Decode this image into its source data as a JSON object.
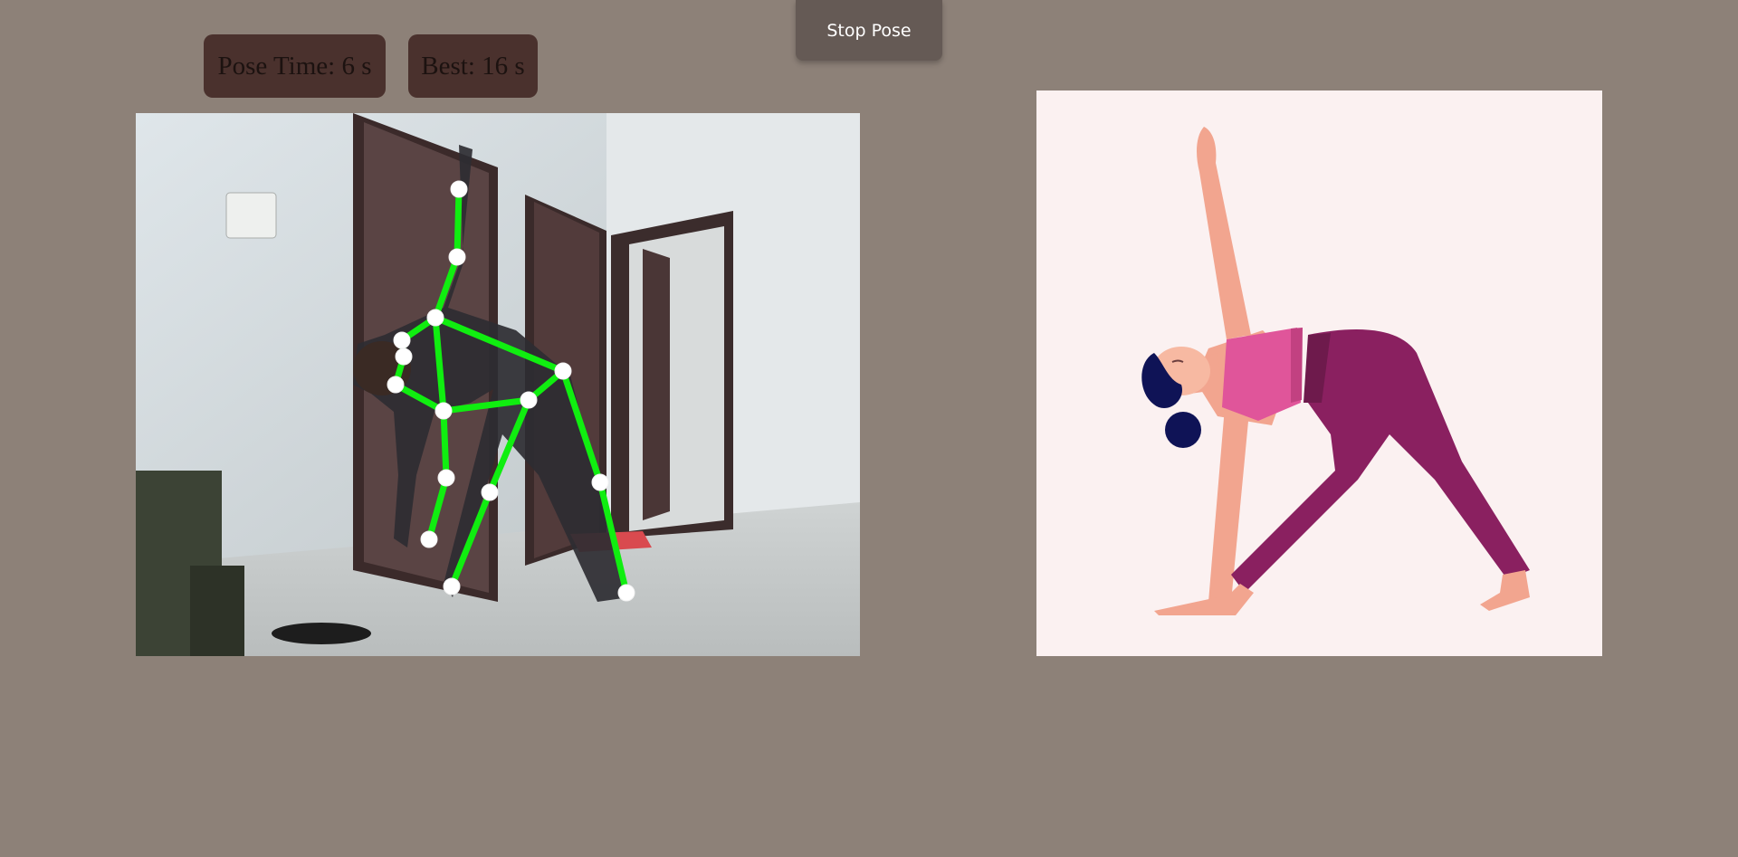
{
  "stats": {
    "pose_time": "Pose Time: 6 s",
    "best_time": "Best: 16 s"
  },
  "controls": {
    "stop_label": "Stop Pose"
  },
  "webcam": {
    "skeleton_color": "#10ee10",
    "keypoint_color": "#ffffff"
  },
  "reference": {
    "pose": "triangle-pose"
  }
}
